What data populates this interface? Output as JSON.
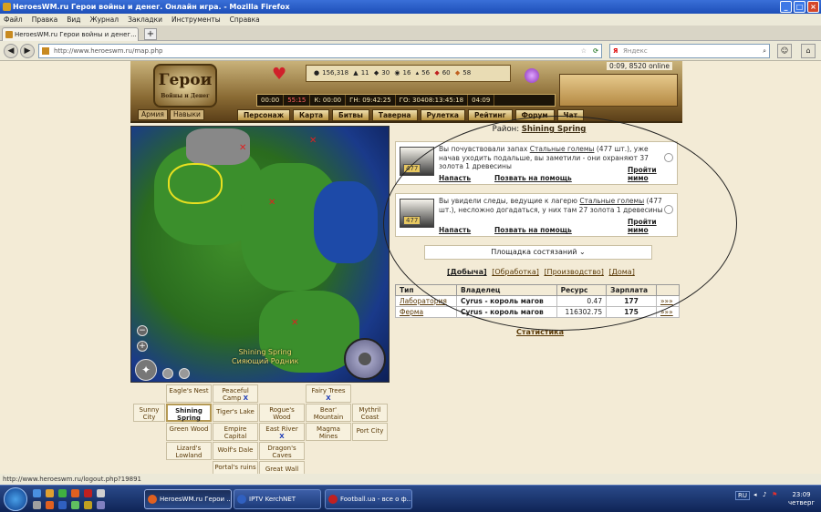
{
  "window": {
    "title": "HeroesWM.ru Герои войны и денег. Онлайн игра. - Mozilla Firefox",
    "minimize": "_",
    "maximize": "□",
    "close": "×"
  },
  "menu": [
    "Файл",
    "Правка",
    "Вид",
    "Журнал",
    "Закладки",
    "Инструменты",
    "Справка"
  ],
  "tab": {
    "label": "HeroesWM.ru Герои войны и денег...",
    "new_tab": "+"
  },
  "nav": {
    "back": "◀",
    "forward": "▶",
    "url": "http://www.heroeswm.ru/map.php",
    "search_placeholder": "Яндекс",
    "search_logo": "Я",
    "home": "⌂"
  },
  "header": {
    "logo_main": "Герои",
    "logo_sub": "Войны и Денег",
    "online": "0:09, 8520 online",
    "resources": [
      {
        "icon": "gold-icon",
        "value": "156,318"
      },
      {
        "icon": "wood-icon",
        "value": "11"
      },
      {
        "icon": "ore-icon",
        "value": "30"
      },
      {
        "icon": "mercury-icon",
        "value": "16"
      },
      {
        "icon": "sulfur-icon",
        "value": "56"
      },
      {
        "icon": "crystal-icon",
        "value": "60"
      },
      {
        "icon": "gem-icon",
        "value": "58"
      }
    ],
    "timers": [
      "00:00",
      "55:15",
      "К: 00:00",
      "ГН: 09:42:25",
      "ГО: 30408:13:45:18",
      "04:09"
    ],
    "left_tabs": [
      "Армия",
      "Навыки"
    ],
    "nav_items": [
      "Персонаж",
      "Карта",
      "Битвы",
      "Таверна",
      "Рулетка",
      "Рейтинг",
      "Форум",
      "Чат"
    ]
  },
  "map": {
    "label_en": "Shining Spring",
    "label_ru": "Сияющий Родник",
    "zoom_out": "−",
    "zoom_in": "+",
    "pan": "✦"
  },
  "grid": [
    {
      "label": "Eagle's Nest"
    },
    {
      "label": "Peaceful Camp",
      "x": "X"
    },
    {
      "label": "Fairy Trees",
      "x": "X"
    },
    {
      "label": "Sunny City"
    },
    {
      "label": "Shining Spring"
    },
    {
      "label": "Tiger's Lake"
    },
    {
      "label": "Rogue's Wood"
    },
    {
      "label": "Bear' Mountain"
    },
    {
      "label": "Mythril Coast"
    },
    {
      "label": "Green Wood"
    },
    {
      "label": "Empire Capital"
    },
    {
      "label": "East River",
      "x": "X"
    },
    {
      "label": "Magma Mines"
    },
    {
      "label": "Port City"
    },
    {
      "label": "Lizard's Lowland"
    },
    {
      "label": "Wolf's Dale"
    },
    {
      "label": "Dragon's Caves"
    },
    {
      "label": "Portal's ruins"
    },
    {
      "label": "Great Wall"
    }
  ],
  "region": {
    "prefix": "Район:",
    "name": "Shining Spring"
  },
  "events": [
    {
      "count": "477",
      "text_before": "Вы почувствовали запах ",
      "link": "Стальные големы",
      "text_after": " (477 шт.), уже начав уходить подальше, вы заметили - они охраняют 37 золота 1 древесины",
      "attack": "Напасть",
      "call": "Позвать на помощь",
      "pass": "Пройти мимо"
    },
    {
      "count": "477",
      "text_before": "Вы увидели следы, ведущие к лагерю ",
      "link": "Стальные големы",
      "text_after": " (477 шт.), несложно догадаться, у них там 27 золота 1 древесины",
      "attack": "Напасть",
      "call": "Позвать на помощь",
      "pass": "Пройти мимо"
    }
  ],
  "arena": {
    "label": "Площадка состязаний",
    "icon": "⌄"
  },
  "subtabs": [
    "[Добыча]",
    "[Обработка]",
    "[Производство]",
    "[Дома]"
  ],
  "buildings": {
    "headers": [
      "Тип",
      "Владелец",
      "Ресурс",
      "Зарплата",
      ""
    ],
    "rows": [
      {
        "type": "Лаборатория",
        "owner": "Cyrus - король магов",
        "resource": "0.47",
        "pay": "177",
        "go": "»»»"
      },
      {
        "type": "Ферма",
        "owner": "Cyrus - король магов",
        "resource": "116302.75",
        "pay": "175",
        "go": "»»»"
      }
    ]
  },
  "stats_link": "Статистика",
  "statusbar": "http://www.heroeswm.ru/logout.php?19891",
  "taskbar": {
    "tasks": [
      "HeroesWM.ru Герои ...",
      "IPTV KerchNET",
      "Football.ua - все о ф..."
    ],
    "lang": "RU",
    "time": "23:09",
    "day": "четверг"
  },
  "colors": {
    "accent": "#5a3a08",
    "header_gold": "#c9b27a",
    "page_bg": "#f3ebd6"
  }
}
